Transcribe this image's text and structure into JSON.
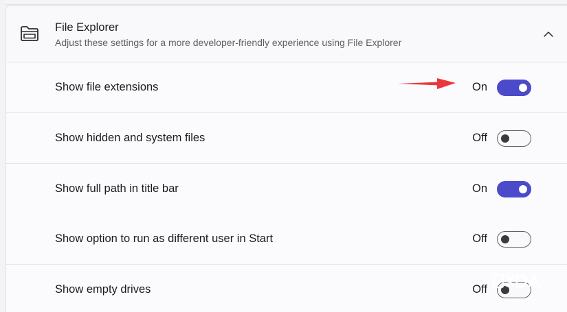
{
  "section": {
    "icon": "folder-icon",
    "title": "File Explorer",
    "subtitle": "Adjust these settings for a more developer-friendly experience using File Explorer",
    "collapse_icon": "chevron-up-icon"
  },
  "settings": [
    {
      "label": "Show file extensions",
      "state_label": "On",
      "on": true
    },
    {
      "label": "Show hidden and system files",
      "state_label": "Off",
      "on": false
    },
    {
      "label": "Show full path in title bar",
      "state_label": "On",
      "on": true
    },
    {
      "label": "Show option to run as different user in Start",
      "state_label": "Off",
      "on": false
    },
    {
      "label": "Show empty drives",
      "state_label": "Off",
      "on": false
    }
  ],
  "annotation": {
    "icon": "red-arrow-icon",
    "color": "#e8383d"
  },
  "watermark": {
    "text": "XDA"
  },
  "colors": {
    "accent": "#4b4acb",
    "arrow": "#e8383d"
  }
}
